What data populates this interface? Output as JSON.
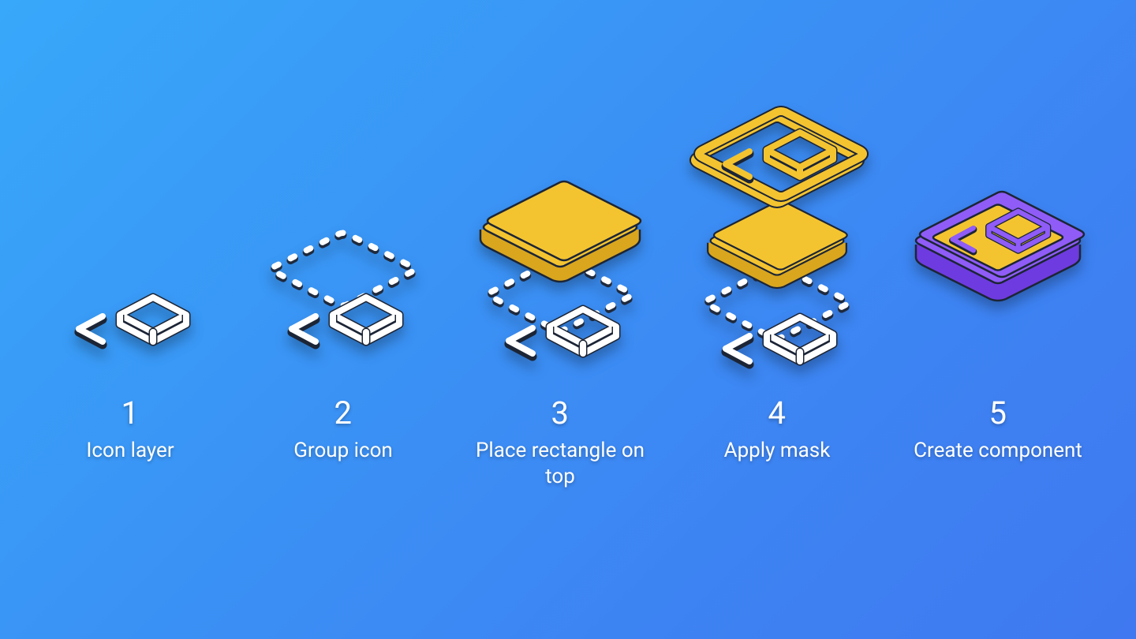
{
  "colors": {
    "bg_start": "#38a8fa",
    "bg_end": "#3f78f0",
    "yellow": "#f4c430",
    "yellow_edge": "#d9a61e",
    "purple": "#8f5cf7",
    "purple_edge": "#6e3be0",
    "outline_dark": "#1c2536",
    "white": "#ffffff"
  },
  "steps": [
    {
      "num": "1",
      "title": "Icon layer"
    },
    {
      "num": "2",
      "title": "Group icon"
    },
    {
      "num": "3",
      "title": "Place rectangle on top"
    },
    {
      "num": "4",
      "title": "Apply mask"
    },
    {
      "num": "5",
      "title": "Create component"
    }
  ]
}
